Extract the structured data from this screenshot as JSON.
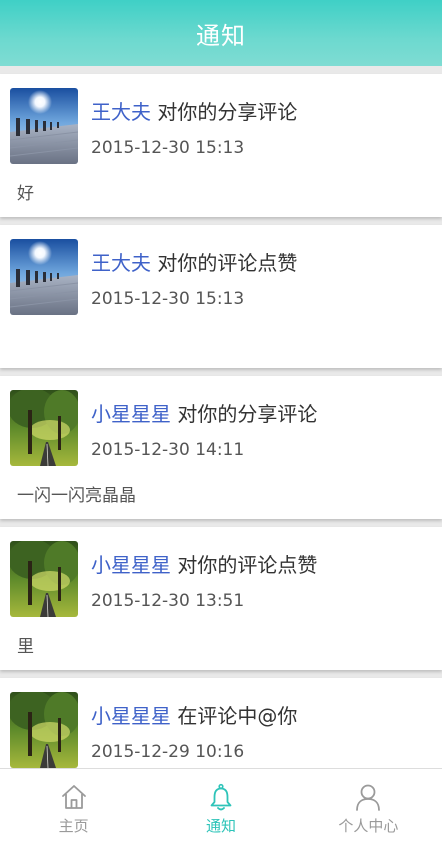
{
  "header": {
    "title": "通知"
  },
  "notifications": [
    {
      "user": "王大夫",
      "action": "对你的分享评论",
      "time": "2015-12-30 15:13",
      "content": "好",
      "avatar": "pier-photo"
    },
    {
      "user": "王大夫",
      "action": "对你的评论点赞",
      "time": "2015-12-30 15:13",
      "content": "",
      "avatar": "pier-photo"
    },
    {
      "user": "小星星星",
      "action": "对你的分享评论",
      "time": "2015-12-30 14:11",
      "content": "一闪一闪亮晶晶",
      "avatar": "tree-road-photo"
    },
    {
      "user": "小星星星",
      "action": "对你的评论点赞",
      "time": "2015-12-30 13:51",
      "content": "里",
      "avatar": "tree-road-photo"
    },
    {
      "user": "小星星星",
      "action": "在评论中@你",
      "time": "2015-12-29 10:16",
      "content": "",
      "avatar": "tree-road-photo"
    }
  ],
  "tabbar": {
    "tabs": [
      {
        "label": "主页",
        "icon": "home-icon",
        "active": false
      },
      {
        "label": "通知",
        "icon": "bell-icon",
        "active": true
      },
      {
        "label": "个人中心",
        "icon": "user-icon",
        "active": false
      }
    ]
  },
  "colors": {
    "header": "#4dd3c9",
    "username": "#3f62c9",
    "active_tab": "#2ec4b9",
    "inactive_tab": "#9a9a9a"
  }
}
